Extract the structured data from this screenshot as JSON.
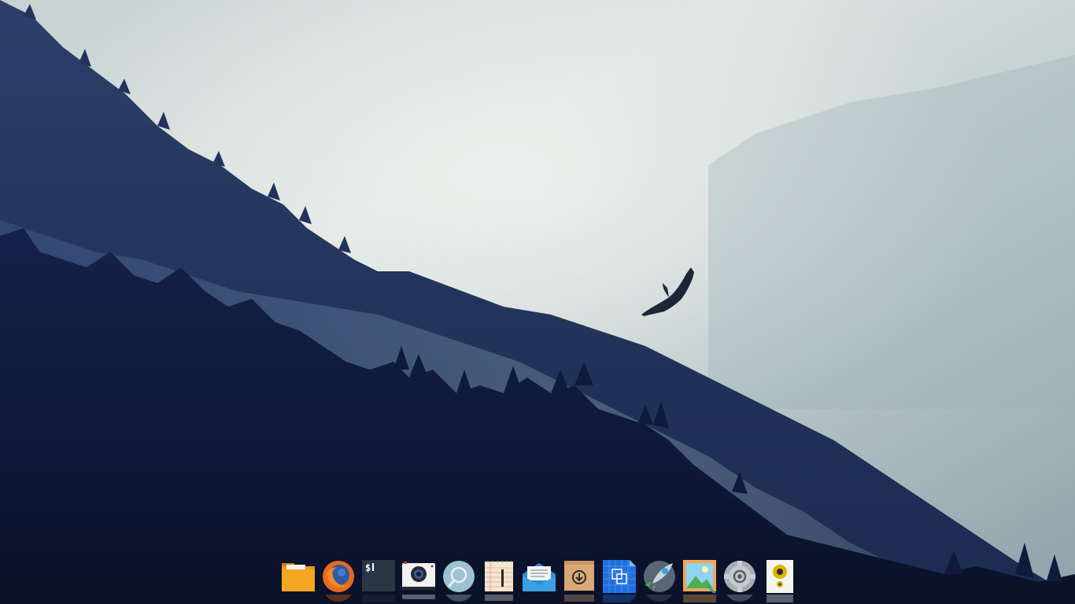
{
  "desktop": {
    "wallpaper": "foggy-forest-mountain-with-eagle",
    "colors": {
      "sky_light": "#dde4e2",
      "sky_mid": "#b9c6c8",
      "fog": "#9fb0b6",
      "mountain_mid": "#3c5580",
      "forest_dark": "#101a38",
      "forest_darkest": "#0a1128"
    }
  },
  "dock": {
    "items": [
      {
        "icon": "file-manager-icon",
        "label": ""
      },
      {
        "icon": "firefox-icon",
        "label": ""
      },
      {
        "icon": "terminal-icon",
        "label": "$"
      },
      {
        "icon": "camera-icon",
        "label": ""
      },
      {
        "icon": "search-icon",
        "label": ""
      },
      {
        "icon": "notes-icon",
        "label": ""
      },
      {
        "icon": "mail-icon",
        "label": ""
      },
      {
        "icon": "archive-icon",
        "label": ""
      },
      {
        "icon": "screenshot-icon",
        "label": ""
      },
      {
        "icon": "launcher-icon",
        "label": ""
      },
      {
        "icon": "image-viewer-icon",
        "label": ""
      },
      {
        "icon": "settings-icon",
        "label": ""
      },
      {
        "icon": "music-player-icon",
        "label": ""
      }
    ]
  }
}
